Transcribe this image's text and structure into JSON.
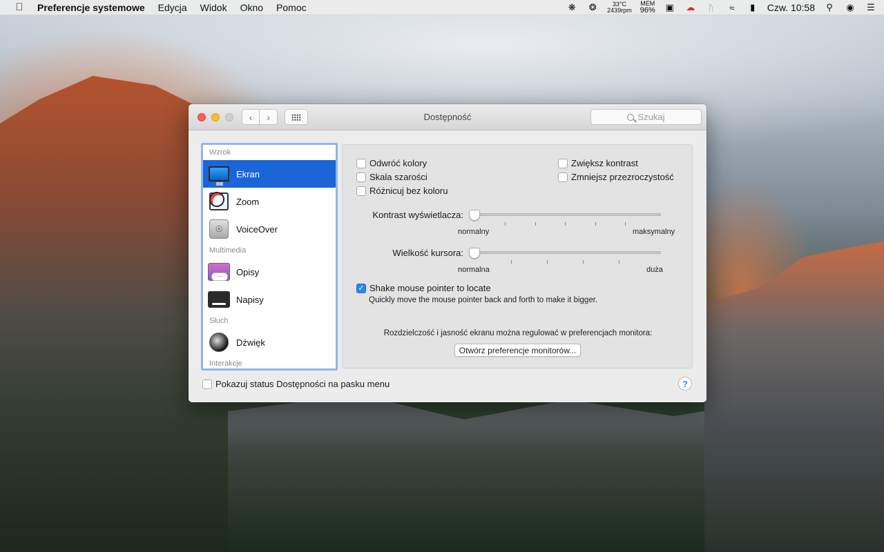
{
  "menubar": {
    "app_name": "Preferencje systemowe",
    "items": [
      "Edycja",
      "Widok",
      "Okno",
      "Pomoc"
    ],
    "temp": "33°C",
    "rpm": "2439rpm",
    "mem_label": "MEM",
    "mem_value": "96%",
    "clock": "Czw. 10:58"
  },
  "window": {
    "title": "Dostępność",
    "search_placeholder": "Szukaj"
  },
  "sidebar": {
    "sections": [
      {
        "header": "Wzrok",
        "items": [
          {
            "label": "Ekran",
            "icon": "monitor-icon",
            "selected": true
          },
          {
            "label": "Zoom",
            "icon": "zoom-icon"
          },
          {
            "label": "VoiceOver",
            "icon": "voiceover-icon"
          }
        ]
      },
      {
        "header": "Multimedia",
        "items": [
          {
            "label": "Opisy",
            "icon": "descriptions-icon"
          },
          {
            "label": "Napisy",
            "icon": "captions-icon"
          }
        ]
      },
      {
        "header": "Słuch",
        "items": [
          {
            "label": "Dźwięk",
            "icon": "speaker-icon"
          }
        ]
      },
      {
        "header": "Interakcje",
        "items": []
      }
    ]
  },
  "panel": {
    "checkboxes": {
      "invert": {
        "label": "Odwróć kolory",
        "checked": false
      },
      "grayscale": {
        "label": "Skala szarości",
        "checked": false
      },
      "differentiate": {
        "label": "Różnicuj bez koloru",
        "checked": false
      },
      "contrast": {
        "label": "Zwiększ kontrast",
        "checked": false
      },
      "transparency": {
        "label": "Zmniejsz przezroczystość",
        "checked": false
      }
    },
    "contrast_slider": {
      "label": "Kontrast wyświetlacza:",
      "min_label": "normalny",
      "max_label": "maksymalny",
      "value": 0
    },
    "cursor_slider": {
      "label": "Wielkość kursora:",
      "min_label": "normalna",
      "max_label": "duża",
      "value": 0
    },
    "shake": {
      "label": "Shake mouse pointer to locate",
      "checked": true,
      "description": "Quickly move the mouse pointer back and forth to make it bigger."
    },
    "monitor_text": "Rozdzielczość i jasność ekranu można regulować w preferencjach monitora:",
    "monitor_button": "Otwórz preferencje monitorów..."
  },
  "footer": {
    "status_label": "Pokazuj status Dostępności na pasku menu",
    "status_checked": false,
    "help": "?"
  },
  "colors": {
    "accent": "#1a65d8",
    "checkbox_on": "#2c86f5"
  }
}
